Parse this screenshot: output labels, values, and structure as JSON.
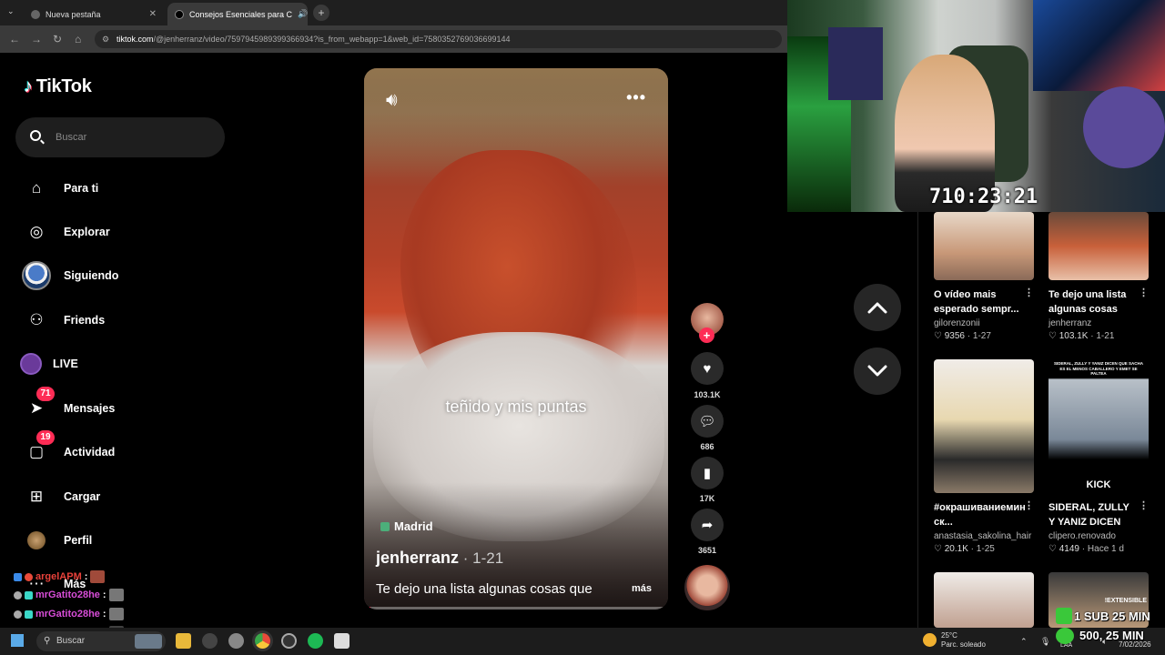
{
  "browser": {
    "tabs": [
      {
        "label": "Nueva pestaña",
        "close": "✕"
      },
      {
        "label": "Consejos Esenciales para C",
        "close": "✕"
      }
    ],
    "new_tab": "+",
    "url_host": "tiktok.com",
    "url_path": "/@jenherranz/video/7597945989399366934?is_from_webapp=1&web_id=7580352769036699144"
  },
  "sidebar": {
    "logo": "TikTok",
    "search_placeholder": "Buscar",
    "items": [
      {
        "label": "Para ti",
        "icon": "home-icon"
      },
      {
        "label": "Explorar",
        "icon": "compass-icon"
      },
      {
        "label": "Siguiendo",
        "icon": "following-avatar"
      },
      {
        "label": "Friends",
        "icon": "friends-icon"
      },
      {
        "label": "LIVE",
        "icon": "live-icon"
      },
      {
        "label": "Mensajes",
        "icon": "messages-icon",
        "badge": "71"
      },
      {
        "label": "Actividad",
        "icon": "activity-icon",
        "badge": "19"
      },
      {
        "label": "Cargar",
        "icon": "upload-icon"
      },
      {
        "label": "Perfil",
        "icon": "profile-avatar"
      },
      {
        "label": "Más",
        "icon": "more-icon"
      }
    ]
  },
  "chat": [
    {
      "user": "argelAPM",
      "sep": ":",
      "color": "#e8413a"
    },
    {
      "user": "mrGatito28he",
      "sep": ":",
      "color": "#d84dd8"
    },
    {
      "user": "mrGatito28he",
      "sep": ":",
      "color": "#d84dd8"
    },
    {
      "user": "mrGatito28he",
      "sep": ":",
      "color": "#d84dd8"
    }
  ],
  "video": {
    "caption_overlay": "teñido y mis puntas",
    "location": "Madrid",
    "author": "jenherranz",
    "date": " · 1-21",
    "description": "Te dejo una lista algunas cosas que",
    "more": "más",
    "progress": 0.02
  },
  "actions": {
    "likes": "103.1K",
    "comments": "686",
    "saves": "17K",
    "shares": "3651"
  },
  "webcam": {
    "timer": "710:23:21"
  },
  "recommendations": [
    {
      "title": "O vídeo mais esperado sempr...",
      "user": "gilorenzonii",
      "likes": "9356",
      "date": "1-27",
      "thumb": "#c8a890"
    },
    {
      "title": "Te dejo una lista algunas cosas qu...",
      "user": "jenherranz",
      "likes": "103.1K",
      "date": "1-21",
      "thumb": "#b85a40"
    },
    {
      "title": "#окрашиваниемин ск...",
      "user": "anastasia_sakolina_hair",
      "likes": "20.1K",
      "date": "1-25",
      "thumb": "#d8c8b0"
    },
    {
      "title": "SIDERAL, ZULLY Y YANIZ DICEN QU...",
      "user": "clipero.renovado",
      "likes": "4149",
      "date": "Hace 1 d",
      "thumb": "#8a9aa8",
      "thumb_text": "SIDERAL, ZULLY Y YANIZ DICEN QUE SACHA ES EL MENOS CABALLERO Y EMET SE PALTEA",
      "thumb_brand": "KICK"
    },
    {
      "title": "",
      "user": "",
      "likes": "",
      "date": "",
      "thumb": "#c0a090"
    },
    {
      "title": "",
      "user": "",
      "likes": "",
      "date": "",
      "thumb": "#b89878",
      "thumb_text": "!EXTENSIBLE"
    }
  ],
  "stream_overlay": {
    "line1": "1 SUB 25 MIN",
    "line2": "500, 25 MIN"
  },
  "taskbar": {
    "search": "Buscar",
    "temp": "25°C",
    "weather": "Parc. soleado",
    "lang": "LAA",
    "date": "7/02/2026"
  },
  "colors": {
    "accent": "#fe2c55",
    "background": "#000000"
  }
}
